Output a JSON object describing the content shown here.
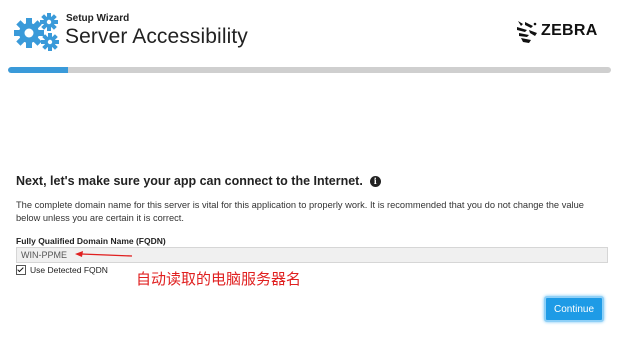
{
  "header": {
    "wizard_label": "Setup Wizard",
    "title": "Server Accessibility",
    "logo_text": "ZEBRA"
  },
  "progress": {
    "fraction": 0.1,
    "color": "#3a9ad9"
  },
  "main": {
    "heading": "Next, let's make sure your app can connect to the Internet.",
    "description": "The complete domain name for this server is vital for this application to properly work. It is recommended that you do not change the value below unless you are certain it is correct.",
    "fqdn_label": "Fully Qualified Domain Name (FQDN)",
    "fqdn_value": "WIN-PPME",
    "checkbox_label": "Use Detected FQDN",
    "checkbox_checked": true,
    "annotation": "自动读取的电脑服务器名",
    "continue_label": "Continue"
  },
  "colors": {
    "accent": "#1e9be6",
    "annotation": "#e02020"
  },
  "icons": {
    "gear": "gears-icon",
    "info": "info-icon",
    "logo": "zebra-logo-icon"
  }
}
